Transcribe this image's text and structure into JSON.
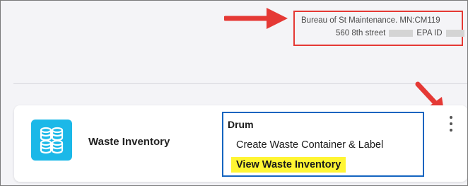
{
  "header": {
    "address_line1": "Bureau of St Maintenance. MN:CM119",
    "address_street": "560 8th street",
    "epa_label": "EPA ID"
  },
  "card": {
    "title": "Waste Inventory",
    "icon": "stacked-containers-icon",
    "icon_color": "#1bb8e8",
    "menu": {
      "header": "Drum",
      "items": [
        {
          "label": "Create Waste Container & Label"
        },
        {
          "label": "View Waste Inventory",
          "highlighted": true
        }
      ]
    }
  },
  "annotations": {
    "highlight_color": "#e53935",
    "menu_outline_color": "#1565c0",
    "menu_highlight_color": "#fff533"
  }
}
